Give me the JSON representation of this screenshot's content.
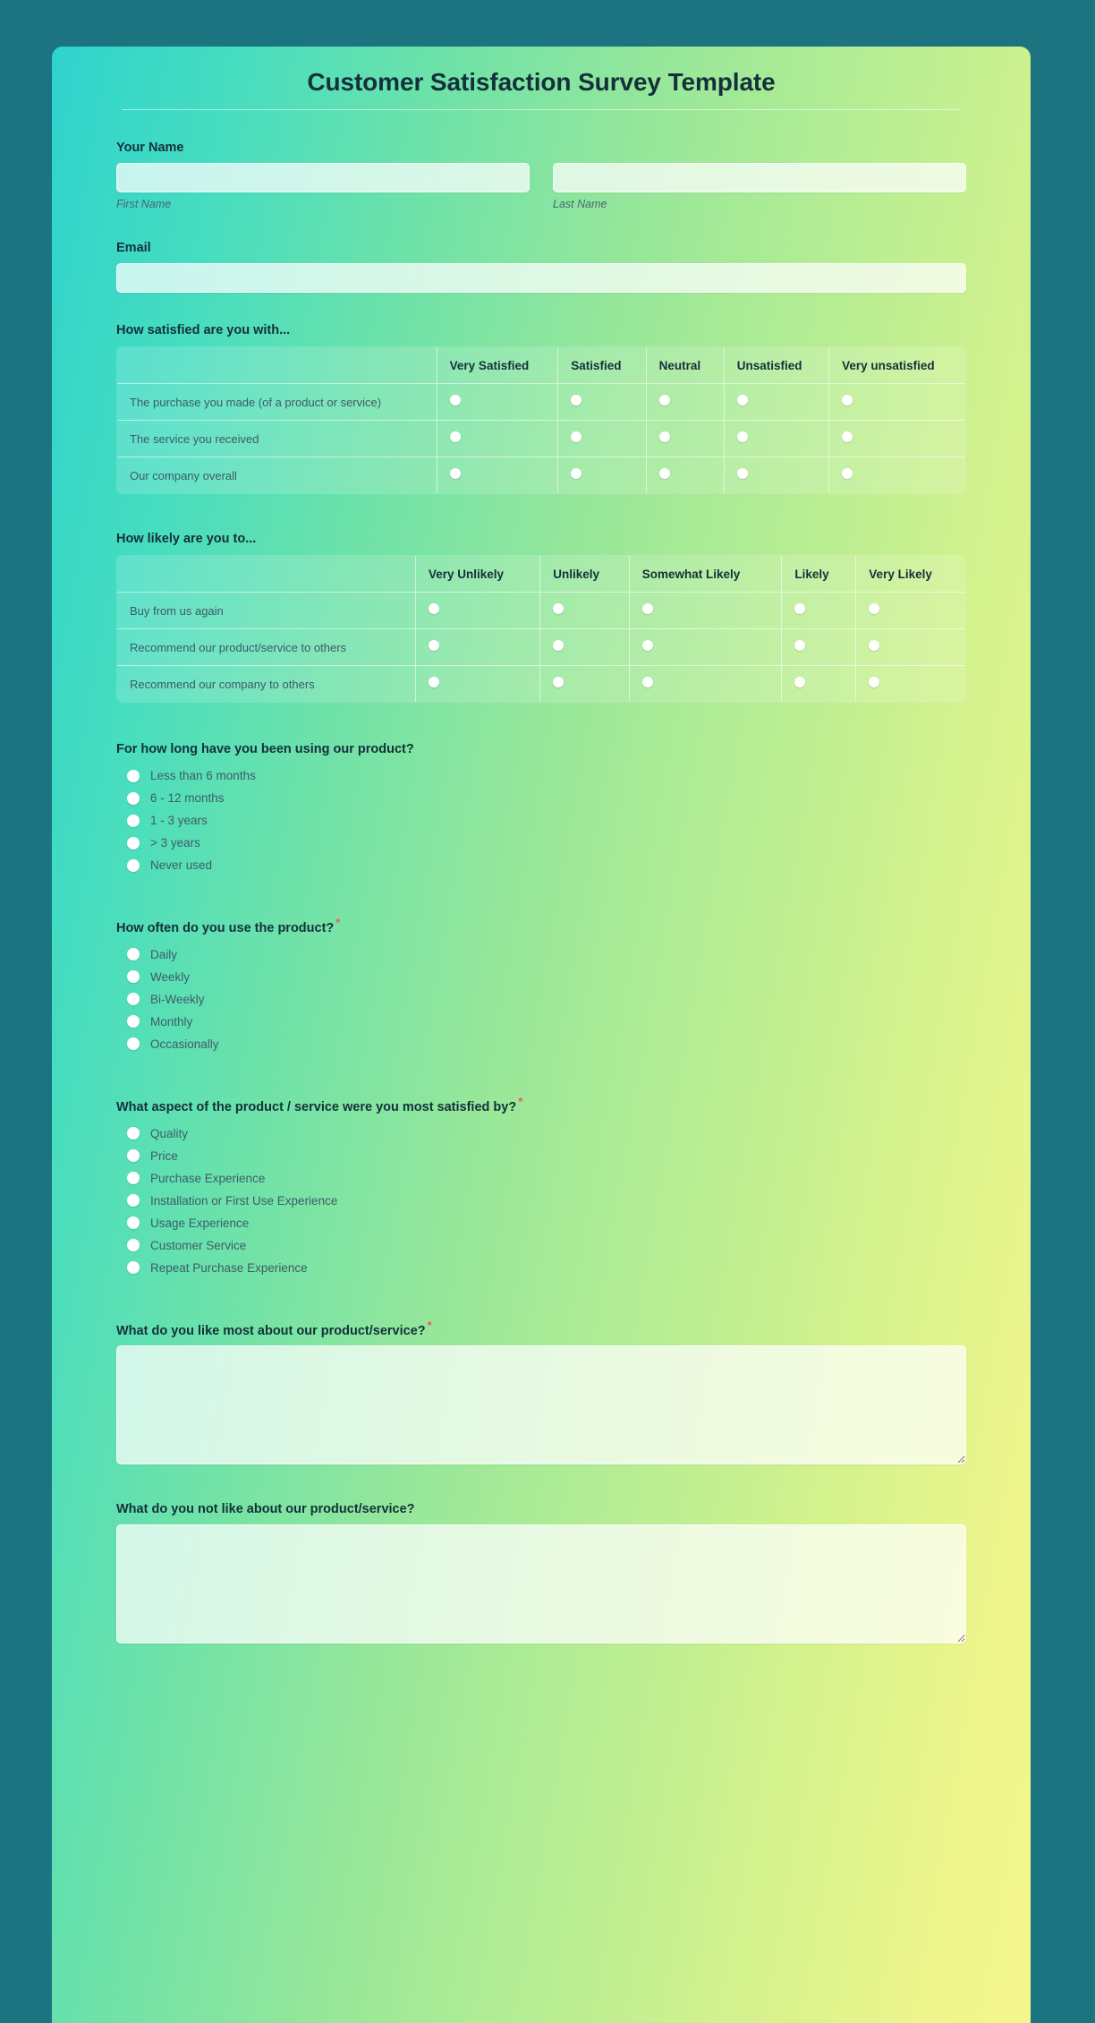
{
  "page": {
    "background_color": "#1b7480",
    "card_gradient_from": "#2ed3cd",
    "card_gradient_to": "#f4f68d",
    "accent_required_color": "#f05a5a"
  },
  "header": {
    "title": "Customer Satisfaction Survey Template"
  },
  "name_field": {
    "label": "Your Name",
    "first": {
      "value": "",
      "placeholder": "",
      "sub_label": "First Name"
    },
    "last": {
      "value": "",
      "placeholder": "",
      "sub_label": "Last Name"
    }
  },
  "email_field": {
    "label": "Email",
    "value": "",
    "placeholder": ""
  },
  "satisfaction_matrix": {
    "label": "How satisfied are you with...",
    "columns": [
      "Very Satisfied",
      "Satisfied",
      "Neutral",
      "Unsatisfied",
      "Very unsatisfied"
    ],
    "rows": [
      "The purchase you made (of a product or service)",
      "The service you received",
      "Our company overall"
    ]
  },
  "likelihood_matrix": {
    "label": "How likely are you to...",
    "columns": [
      "Very Unlikely",
      "Unlikely",
      "Somewhat Likely",
      "Likely",
      "Very Likely"
    ],
    "rows": [
      "Buy from us again",
      "Recommend our product/service to others",
      "Recommend our company to others"
    ]
  },
  "duration_question": {
    "label": "For how long have you been using our product?",
    "required": false,
    "options": [
      "Less than 6 months",
      "6 - 12 months",
      "1 - 3 years",
      "> 3 years",
      "Never used"
    ]
  },
  "frequency_question": {
    "label": "How often do you use the product?",
    "required": true,
    "required_mark": "*",
    "options": [
      "Daily",
      "Weekly",
      "Bi-Weekly",
      "Monthly",
      "Occasionally"
    ]
  },
  "aspect_question": {
    "label": "What aspect of the product / service were you most satisfied by?",
    "required": true,
    "required_mark": "*",
    "options": [
      "Quality",
      "Price",
      "Purchase Experience",
      "Installation or First Use Experience",
      "Usage Experience",
      "Customer Service",
      "Repeat Purchase Experience"
    ]
  },
  "like_most_question": {
    "label": "What do you like most about our product/service?",
    "required": true,
    "required_mark": "*",
    "value": "",
    "placeholder": ""
  },
  "not_like_question": {
    "label": "What do you not like about our product/service?",
    "required": false,
    "value": "",
    "placeholder": ""
  }
}
